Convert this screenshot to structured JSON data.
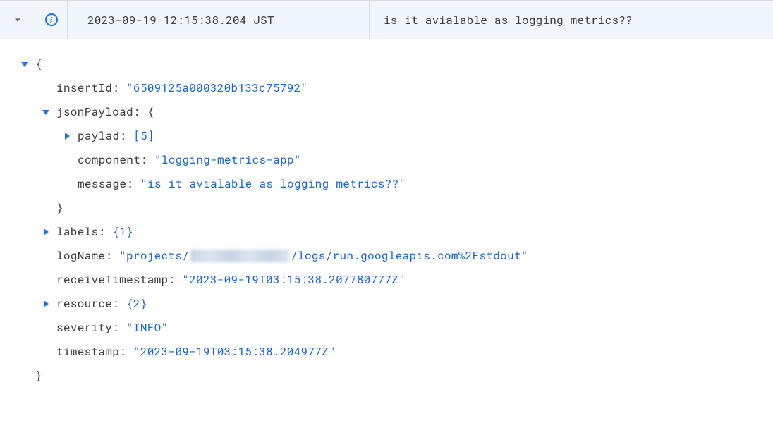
{
  "header": {
    "timestamp": "2023-09-19 12:15:38.204 JST",
    "message": "is it avialable as logging metrics??",
    "severity_icon_label": "i"
  },
  "json": {
    "open_brace": "{",
    "insertId": {
      "key": "insertId:",
      "val": "\"6509125a000320b133c75792\""
    },
    "jsonPayload": {
      "key": "jsonPayload:",
      "open": "{",
      "paylad": {
        "key": "paylad:",
        "val": "[5]"
      },
      "component": {
        "key": "component:",
        "val": "\"logging-metrics-app\""
      },
      "message": {
        "key": "message:",
        "val": "\"is it avialable as logging metrics??\""
      },
      "close": "}"
    },
    "labels": {
      "key": "labels:",
      "val": "{1}"
    },
    "logName": {
      "key": "logName:",
      "prefix": "\"projects/",
      "suffix": "/logs/run.googleapis.com%2Fstdout\""
    },
    "receiveTimestamp": {
      "key": "receiveTimestamp:",
      "val": "\"2023-09-19T03:15:38.207780777Z\""
    },
    "resource": {
      "key": "resource:",
      "val": "{2}"
    },
    "severity": {
      "key": "severity:",
      "val": "\"INFO\""
    },
    "timestamp": {
      "key": "timestamp:",
      "val": "\"2023-09-19T03:15:38.204977Z\""
    },
    "close_brace": "}"
  }
}
